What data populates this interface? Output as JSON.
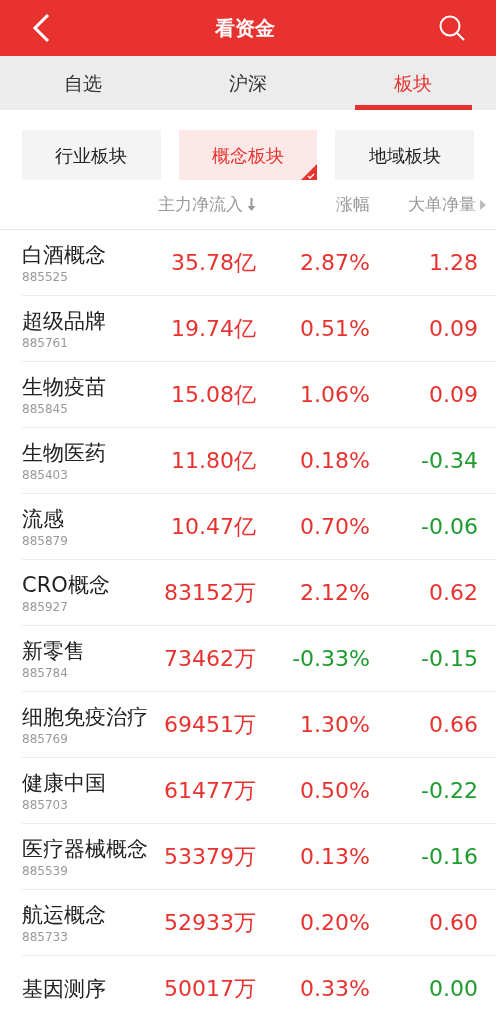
{
  "header": {
    "title": "看资金"
  },
  "tabs": [
    {
      "label": "自选",
      "selected": false
    },
    {
      "label": "沪深",
      "selected": false
    },
    {
      "label": "板块",
      "selected": true
    }
  ],
  "segments": [
    {
      "label": "行业板块",
      "selected": false
    },
    {
      "label": "概念板块",
      "selected": true
    },
    {
      "label": "地域板块",
      "selected": false
    }
  ],
  "columns": [
    {
      "label": "主力净流入",
      "sorted": true
    },
    {
      "label": "涨幅"
    },
    {
      "label": "大单净量",
      "more": true
    }
  ],
  "rows": [
    {
      "name": "白酒概念",
      "code": "885525",
      "flow": "35.78亿",
      "change": "2.87%",
      "change_up": true,
      "big": "1.28",
      "big_up": true
    },
    {
      "name": "超级品牌",
      "code": "885761",
      "flow": "19.74亿",
      "change": "0.51%",
      "change_up": true,
      "big": "0.09",
      "big_up": true
    },
    {
      "name": "生物疫苗",
      "code": "885845",
      "flow": "15.08亿",
      "change": "1.06%",
      "change_up": true,
      "big": "0.09",
      "big_up": true
    },
    {
      "name": "生物医药",
      "code": "885403",
      "flow": "11.80亿",
      "change": "0.18%",
      "change_up": true,
      "big": "-0.34",
      "big_up": false
    },
    {
      "name": "流感",
      "code": "885879",
      "flow": "10.47亿",
      "change": "0.70%",
      "change_up": true,
      "big": "-0.06",
      "big_up": false
    },
    {
      "name": "CRO概念",
      "code": "885927",
      "flow": "83152万",
      "change": "2.12%",
      "change_up": true,
      "big": "0.62",
      "big_up": true
    },
    {
      "name": "新零售",
      "code": "885784",
      "flow": "73462万",
      "change": "-0.33%",
      "change_up": false,
      "big": "-0.15",
      "big_up": false
    },
    {
      "name": "细胞免疫治疗",
      "code": "885769",
      "flow": "69451万",
      "change": "1.30%",
      "change_up": true,
      "big": "0.66",
      "big_up": true
    },
    {
      "name": "健康中国",
      "code": "885703",
      "flow": "61477万",
      "change": "0.50%",
      "change_up": true,
      "big": "-0.22",
      "big_up": false
    },
    {
      "name": "医疗器械概念",
      "code": "885539",
      "flow": "53379万",
      "change": "0.13%",
      "change_up": true,
      "big": "-0.16",
      "big_up": false
    },
    {
      "name": "航运概念",
      "code": "885733",
      "flow": "52933万",
      "change": "0.20%",
      "change_up": true,
      "big": "0.60",
      "big_up": true
    },
    {
      "name": "基因测序",
      "flow": "50017万",
      "change": "0.33%",
      "change_up": true,
      "big": "0.00",
      "big_up": false
    }
  ]
}
